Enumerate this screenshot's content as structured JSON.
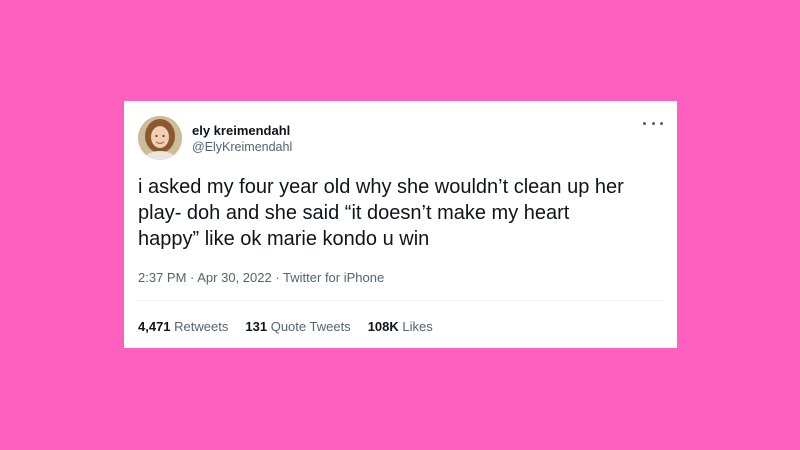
{
  "tweet": {
    "display_name": "ely kreimendahl",
    "handle": "@ElyKreimendahl",
    "text": "i asked my four year old why she wouldn’t clean up her\nplay- doh and she said “it doesn’t make my heart\nhappy” like ok marie kondo u win",
    "time": "2:37 PM",
    "date": "Apr 30, 2022",
    "source": "Twitter for iPhone",
    "separator": " · "
  },
  "stats": {
    "retweets_count": "4,471",
    "retweets_label": "Retweets",
    "quotes_count": "131",
    "quotes_label": "Quote Tweets",
    "likes_count": "108K",
    "likes_label": "Likes"
  },
  "colors": {
    "background": "#ff5fbf",
    "card": "#ffffff",
    "text_primary": "#0f1419",
    "text_secondary": "#536471"
  },
  "icons": {
    "more": "more-horizontal-icon"
  }
}
